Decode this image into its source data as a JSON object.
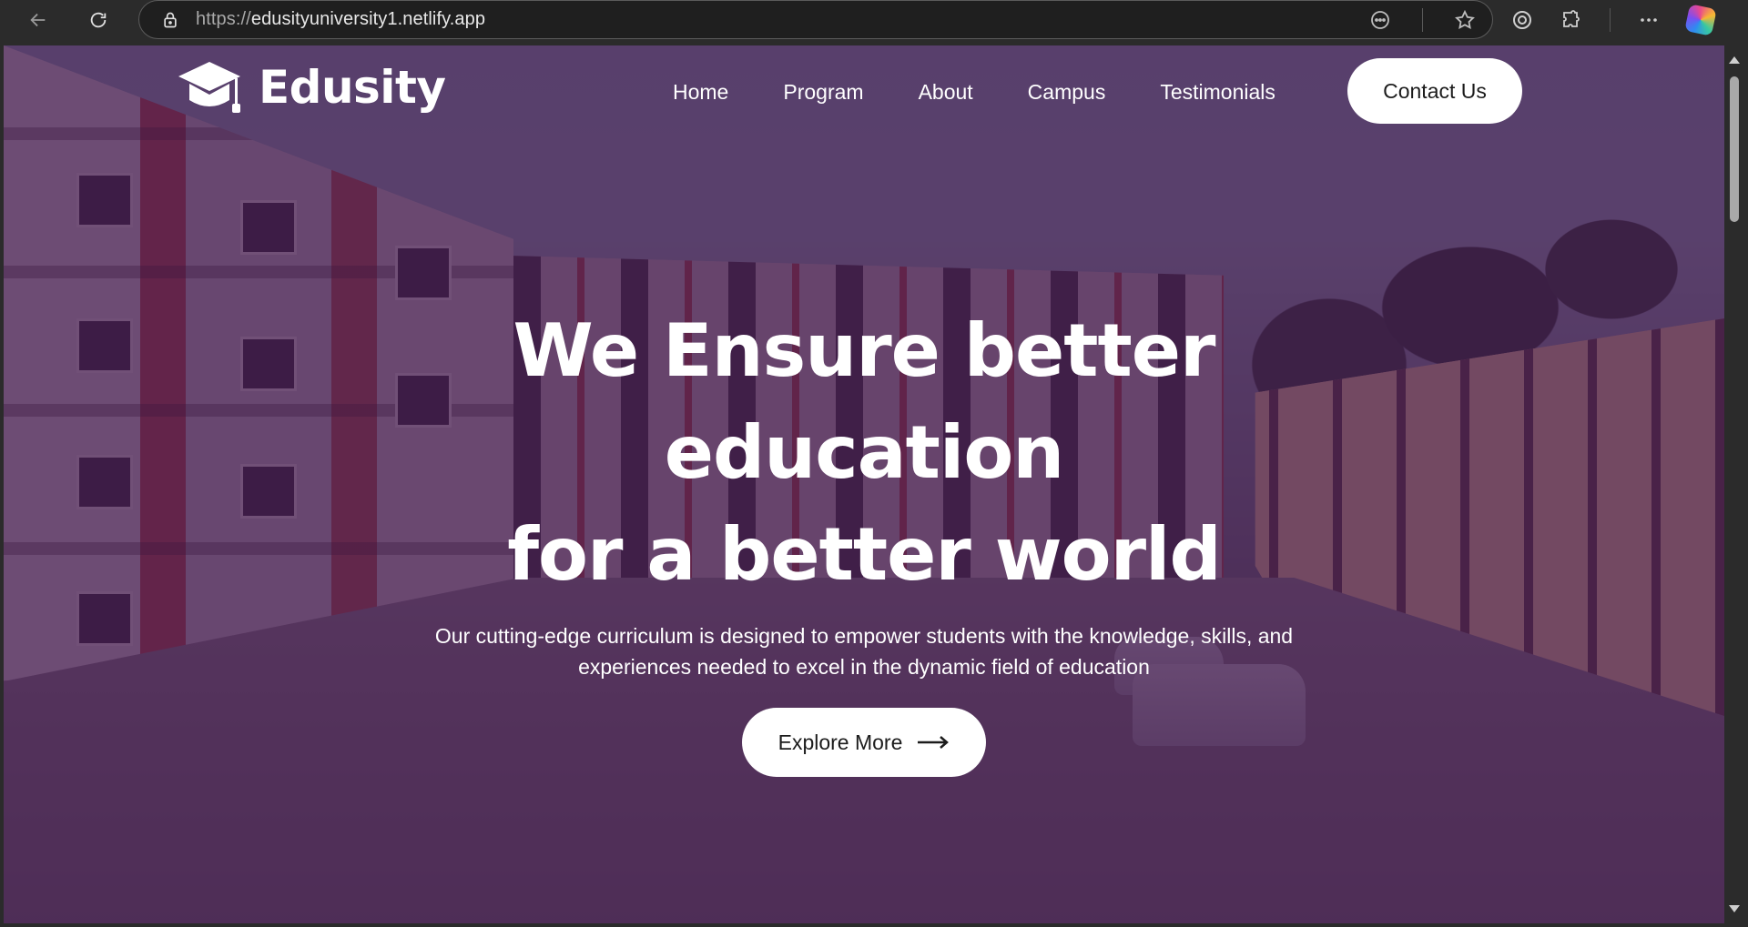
{
  "browser": {
    "url_protocol": "https://",
    "url_host": "edusityuniversity1.netlify.app",
    "icons": [
      "back-icon",
      "reload-icon",
      "lock-icon",
      "reader-icon",
      "star-icon",
      "circle-icon",
      "puzzle-icon",
      "more-icon",
      "copilot-icon"
    ]
  },
  "site": {
    "brand": "Edusity",
    "nav": {
      "items": [
        "Home",
        "Program",
        "About",
        "Campus",
        "Testimonials"
      ],
      "contact_label": "Contact Us"
    },
    "hero": {
      "title_line1": "We Ensure better education",
      "title_line2": "for a better world",
      "subtitle": "Our cutting-edge curriculum is designed to empower students with the knowledge, skills, and experiences needed to excel in the dynamic field of education",
      "cta_label": "Explore More"
    },
    "colors": {
      "overlay": "#421850",
      "button_bg": "#ffffff",
      "text": "#ffffff"
    }
  }
}
